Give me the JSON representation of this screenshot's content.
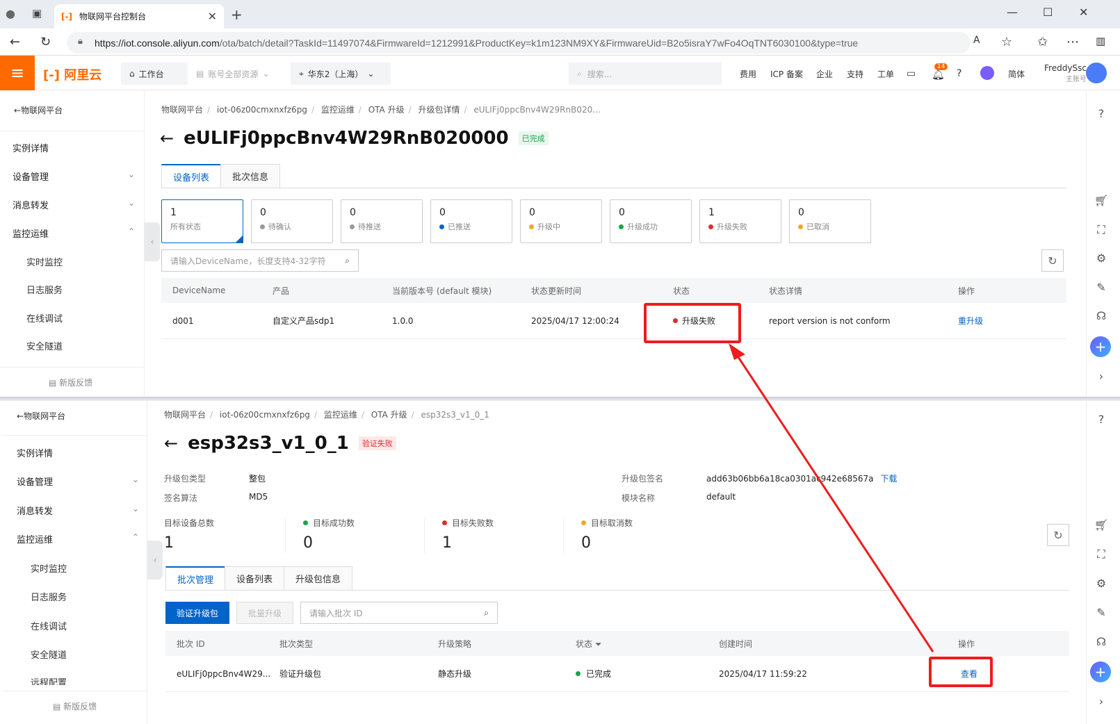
{
  "browser": {
    "tab_title": "物联网平台控制台",
    "url_host": "https://iot.console.aliyun.com",
    "url_path": "/ota/batch/detail?TaskId=11497074&FirmwareId=1212991&ProductKey=k1m123NM9XY&FirmwareUid=B2o5israY7wFo4OqTNT6030100&type=true"
  },
  "appbar": {
    "logo": "阿里云",
    "workbench": "工作台",
    "resources": "账号全部资源",
    "region": "华东2（上海）",
    "search_placeholder": "搜索...",
    "nav": [
      "费用",
      "ICP 备案",
      "企业",
      "支持",
      "工单"
    ],
    "notif_count": "14",
    "lang": "简体",
    "user_name": "FreddySsc",
    "user_role": "主账号"
  },
  "sidebar": {
    "back": "物联网平台",
    "items": [
      "实例详情",
      "设备管理",
      "消息转发",
      "监控运维"
    ],
    "subitems": [
      "实时监控",
      "日志服务",
      "在线调试",
      "安全隧道",
      "远程配置"
    ],
    "feedback": "新版反馈"
  },
  "top_panel": {
    "breadcrumb": [
      "物联网平台",
      "iot-06z00cmxnxfz6pg",
      "监控运维",
      "OTA 升级",
      "升级包详情",
      "eULIFj0ppcBnv4W29RnB020..."
    ],
    "title": "eULIFj0ppcBnv4W29RnB020000",
    "status_tag": "已完成",
    "tabs": [
      "设备列表",
      "批次信息"
    ],
    "status_cards": [
      {
        "count": "1",
        "label": "所有状态",
        "color": ""
      },
      {
        "count": "0",
        "label": "待确认",
        "color": "#999999"
      },
      {
        "count": "0",
        "label": "待推送",
        "color": "#999999"
      },
      {
        "count": "0",
        "label": "已推送",
        "color": "#0064c8"
      },
      {
        "count": "0",
        "label": "升级中",
        "color": "#f5a623"
      },
      {
        "count": "0",
        "label": "升级成功",
        "color": "#1aa34a"
      },
      {
        "count": "1",
        "label": "升级失败",
        "color": "#e02b2b"
      },
      {
        "count": "0",
        "label": "已取消",
        "color": "#f5a623"
      }
    ],
    "search_placeholder": "请输入DeviceName，长度支持4-32字符",
    "columns": [
      "DeviceName",
      "产品",
      "当前版本号 (default 模块)",
      "状态更新时间",
      "状态",
      "状态详情",
      "操作"
    ],
    "row": {
      "device": "d001",
      "product": "自定义产品sdp1",
      "version": "1.0.0",
      "time": "2025/04/17 12:00:24",
      "status": "升级失败",
      "detail": "report version is not conform",
      "action": "重升级"
    }
  },
  "bottom_panel": {
    "breadcrumb": [
      "物联网平台",
      "iot-06z00cmxnxfz6pg",
      "监控运维",
      "OTA 升级",
      "esp32s3_v1_0_1"
    ],
    "title": "esp32s3_v1_0_1",
    "status_tag": "验证失败",
    "info": {
      "pkg_type_k": "升级包类型",
      "pkg_type_v": "整包",
      "sign_algo_k": "签名算法",
      "sign_algo_v": "MD5",
      "sign_k": "升级包签名",
      "sign_v": "add63b06bb6a18ca0301ac942e68567a",
      "download": "下载",
      "module_k": "模块名称",
      "module_v": "default"
    },
    "stats": [
      {
        "label": "目标设备总数",
        "value": "1",
        "color": ""
      },
      {
        "label": "目标成功数",
        "value": "0",
        "color": "#1aa34a"
      },
      {
        "label": "目标失败数",
        "value": "1",
        "color": "#e02b2b"
      },
      {
        "label": "目标取消数",
        "value": "0",
        "color": "#f5a623"
      }
    ],
    "tabs": [
      "批次管理",
      "设备列表",
      "升级包信息"
    ],
    "btn_verify": "验证升级包",
    "btn_batch": "批量升级",
    "search_placeholder": "请输入批次 ID",
    "columns": [
      "批次 ID",
      "批次类型",
      "升级策略",
      "状态",
      "创建时间",
      "操作"
    ],
    "row": {
      "id": "eULIFj0ppcBnv4W29...",
      "type": "验证升级包",
      "strategy": "静态升级",
      "status": "已完成",
      "time": "2025/04/17 11:59:22",
      "action": "查看"
    }
  }
}
